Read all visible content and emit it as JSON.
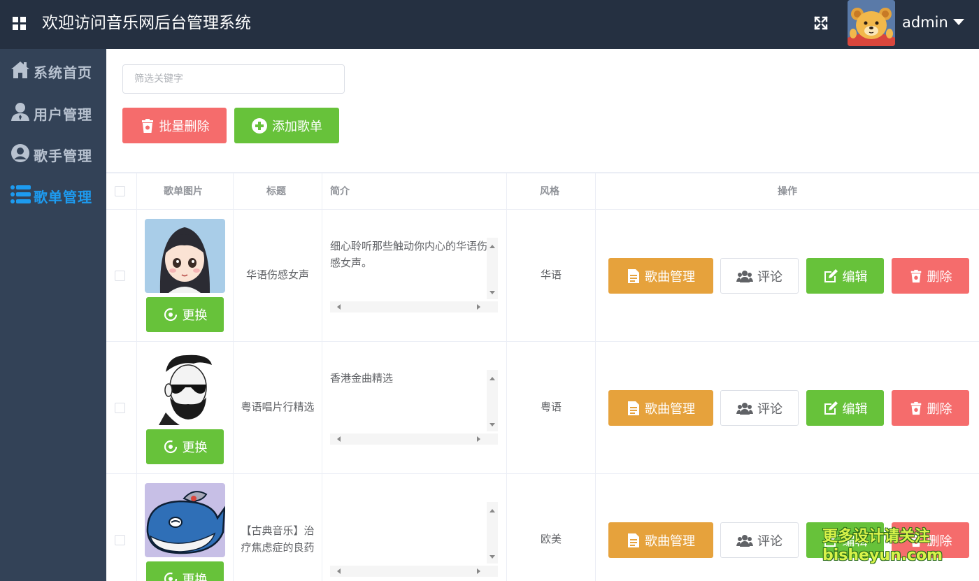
{
  "header": {
    "app_title": "欢迎访问音乐网后台管理系统",
    "username": "admin"
  },
  "sidebar": {
    "items": [
      {
        "label": "系统首页",
        "icon": "home-icon",
        "active": false
      },
      {
        "label": "用户管理",
        "icon": "user-icon",
        "active": false
      },
      {
        "label": "歌手管理",
        "icon": "singer-icon",
        "active": false
      },
      {
        "label": "歌单管理",
        "icon": "list-icon",
        "active": true
      }
    ]
  },
  "toolbar": {
    "search_placeholder": "筛选关键字",
    "batch_delete_label": "批量删除",
    "add_playlist_label": "添加歌单"
  },
  "table": {
    "headers": {
      "image": "歌单图片",
      "title": "标题",
      "intro": "简介",
      "style": "风格",
      "actions": "操作"
    },
    "rows": [
      {
        "title": "华语伤感女声",
        "intro": "细心聆听那些触动你内心的华语伤感女声。",
        "style": "华语",
        "image": "girl-avatar"
      },
      {
        "title": "粤语唱片行精选",
        "intro": "香港金曲精选",
        "style": "粤语",
        "image": "bearded-man-avatar"
      },
      {
        "title": "【古典音乐】治疗焦虑症的良药",
        "intro": "",
        "style": "欧美",
        "image": "whale-avatar"
      }
    ],
    "change_label": "更换",
    "song_manage_label": "歌曲管理",
    "comment_label": "评论",
    "edit_label": "编辑",
    "delete_label": "删除"
  },
  "watermark": {
    "line1": "更多设计请关注",
    "line2": "bisheyun.com"
  },
  "colors": {
    "header_bg": "#253041",
    "sidebar_bg": "#334257",
    "active": "#1d9bf0",
    "danger": "#f56c6c",
    "success": "#67c23a",
    "warning": "#e6a23c"
  }
}
